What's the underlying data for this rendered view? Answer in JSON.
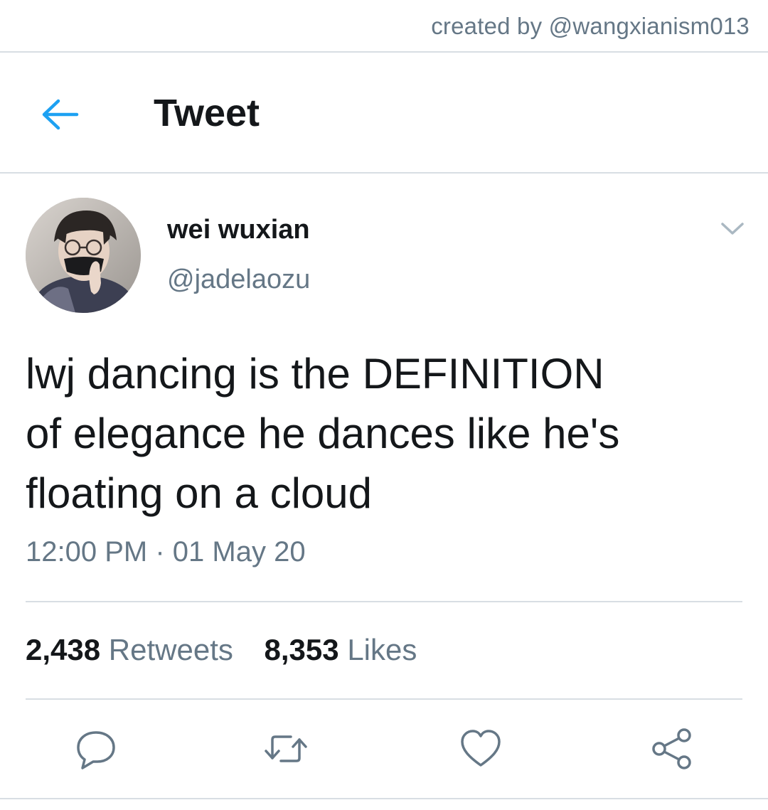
{
  "credit": "created by @wangxianism013",
  "header": {
    "title": "Tweet",
    "back_icon": "arrow-left-icon"
  },
  "author": {
    "display_name": "wei wuxian",
    "handle": "@jadelaozu"
  },
  "tweet": {
    "text_lines": [
      "lwj dancing is the DEFINITION",
      "of elegance he dances like he's",
      "floating on a cloud"
    ],
    "time": "12:00 PM",
    "separator": "·",
    "date": "01 May 20"
  },
  "stats": {
    "retweets_count": "2,438",
    "retweets_label": "Retweets",
    "likes_count": "8,353",
    "likes_label": "Likes"
  },
  "actions": [
    {
      "name": "reply",
      "icon": "speech-bubble-icon"
    },
    {
      "name": "retweet",
      "icon": "retweet-icon"
    },
    {
      "name": "like",
      "icon": "heart-icon"
    },
    {
      "name": "share",
      "icon": "share-icon"
    }
  ],
  "colors": {
    "accent": "#1da1f2",
    "text_primary": "#14171a",
    "text_secondary": "#657786",
    "divider": "#d8dee3"
  }
}
